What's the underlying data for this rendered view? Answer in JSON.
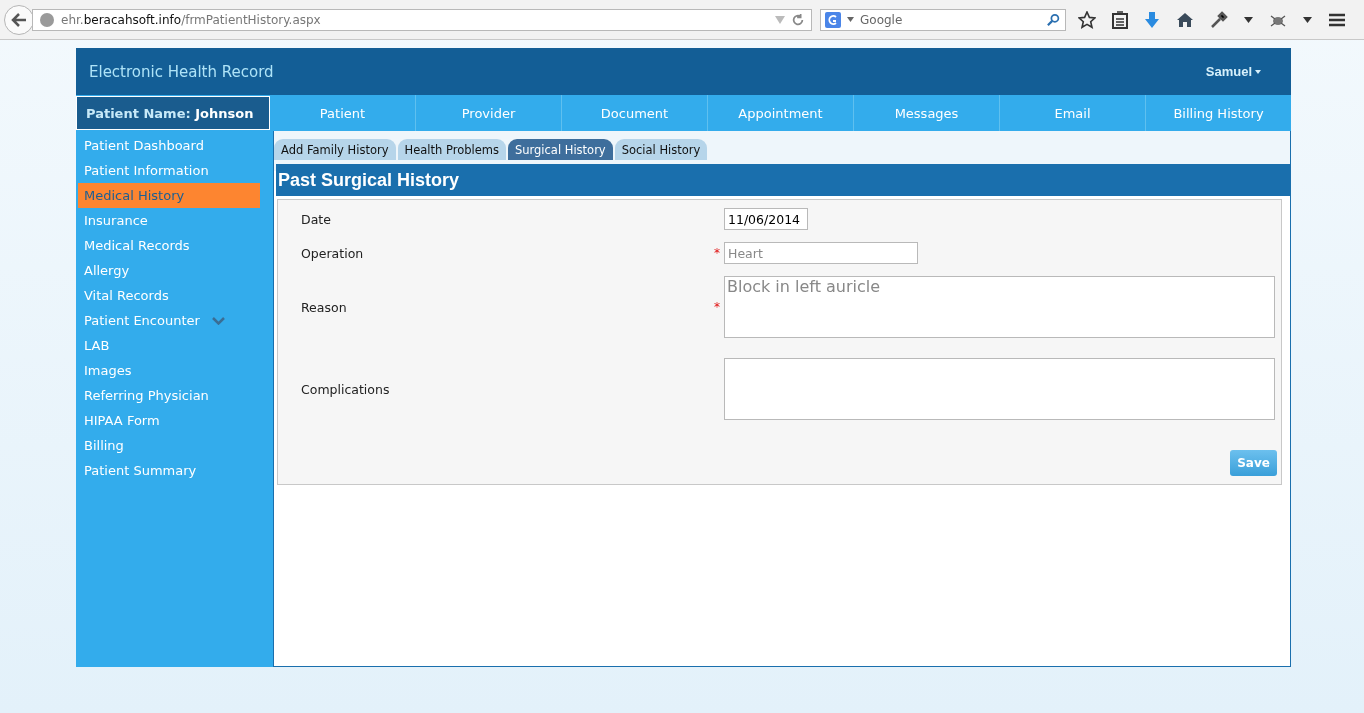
{
  "browser": {
    "url_prefix": "ehr.",
    "url_domain": "beracahsoft.info",
    "url_path": "/frmPatientHistory.aspx",
    "search_placeholder": "Google"
  },
  "app": {
    "title": "Electronic Health Record",
    "user": "Samuel"
  },
  "patient": {
    "label": "Patient Name:",
    "name": "Johnson"
  },
  "nav": [
    "Patient",
    "Provider",
    "Document",
    "Appointment",
    "Messages",
    "Email",
    "Billing History"
  ],
  "sidebar": [
    {
      "label": "Patient Dashboard",
      "selected": false,
      "expandable": false
    },
    {
      "label": "Patient Information",
      "selected": false,
      "expandable": false
    },
    {
      "label": "Medical History",
      "selected": true,
      "expandable": false
    },
    {
      "label": "Insurance",
      "selected": false,
      "expandable": false
    },
    {
      "label": "Medical Records",
      "selected": false,
      "expandable": false
    },
    {
      "label": "Allergy",
      "selected": false,
      "expandable": false
    },
    {
      "label": "Vital Records",
      "selected": false,
      "expandable": false
    },
    {
      "label": "Patient Encounter",
      "selected": false,
      "expandable": true
    },
    {
      "label": "LAB",
      "selected": false,
      "expandable": false
    },
    {
      "label": "Images",
      "selected": false,
      "expandable": false
    },
    {
      "label": "Referring Physician",
      "selected": false,
      "expandable": false
    },
    {
      "label": "HIPAA Form",
      "selected": false,
      "expandable": false
    },
    {
      "label": "Billing",
      "selected": false,
      "expandable": false
    },
    {
      "label": "Patient Summary",
      "selected": false,
      "expandable": false
    }
  ],
  "tabs": [
    {
      "label": "Add Family History",
      "selected": false
    },
    {
      "label": "Health Problems",
      "selected": false
    },
    {
      "label": "Surgical History",
      "selected": true
    },
    {
      "label": "Social History",
      "selected": false
    }
  ],
  "form": {
    "title": "Past Surgical History",
    "required_mark": "*",
    "save_button": "Save",
    "fields": [
      {
        "label": "Date",
        "kind": "date",
        "value": "11/06/2014",
        "required": false
      },
      {
        "label": "Operation",
        "kind": "text",
        "placeholder": "Heart",
        "required": true
      },
      {
        "label": "Reason",
        "kind": "textarea",
        "placeholder": "Block in left auricle",
        "required": true
      },
      {
        "label": "Complications",
        "kind": "textarea",
        "required": false
      }
    ]
  }
}
